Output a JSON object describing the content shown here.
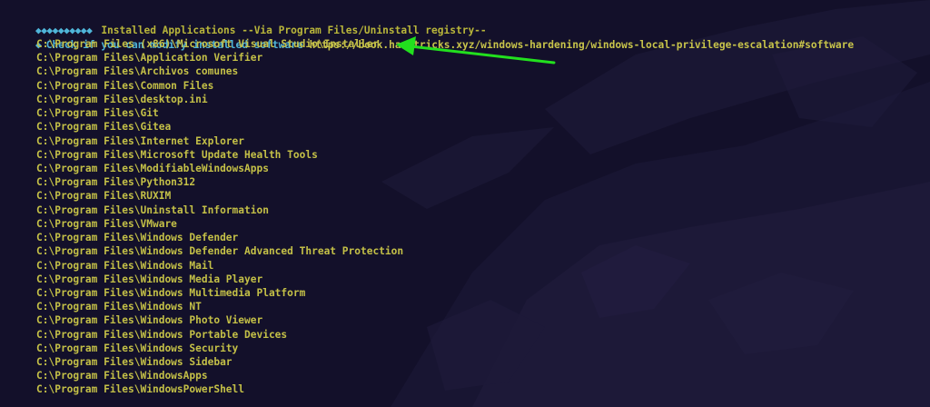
{
  "header": {
    "diamonds": "◆◆◆◆◆◆◆◆◆◆",
    "title": "Installed Applications --Via Program Files/Uninstall registry--"
  },
  "check": {
    "bullet": "◆",
    "text": "Check if you can modify installed software",
    "url": "https://book.hacktricks.xyz/windows-hardening/windows-local-privilege-escalation#software"
  },
  "paths": [
    "C:\\Program Files (x86)\\Microsoft Visual Studio\\Installer",
    "C:\\Program Files\\Application Verifier",
    "C:\\Program Files\\Archivos comunes",
    "C:\\Program Files\\Common Files",
    "C:\\Program Files\\desktop.ini",
    "C:\\Program Files\\Git",
    "C:\\Program Files\\Gitea",
    "C:\\Program Files\\Internet Explorer",
    "C:\\Program Files\\Microsoft Update Health Tools",
    "C:\\Program Files\\ModifiableWindowsApps",
    "C:\\Program Files\\Python312",
    "C:\\Program Files\\RUXIM",
    "C:\\Program Files\\Uninstall Information",
    "C:\\Program Files\\VMware",
    "C:\\Program Files\\Windows Defender",
    "C:\\Program Files\\Windows Defender Advanced Threat Protection",
    "C:\\Program Files\\Windows Mail",
    "C:\\Program Files\\Windows Media Player",
    "C:\\Program Files\\Windows Multimedia Platform",
    "C:\\Program Files\\Windows NT",
    "C:\\Program Files\\Windows Photo Viewer",
    "C:\\Program Files\\Windows Portable Devices",
    "C:\\Program Files\\Windows Security",
    "C:\\Program Files\\Windows Sidebar",
    "C:\\Program Files\\WindowsApps",
    "C:\\Program Files\\WindowsPowerShell"
  ],
  "colors": {
    "background": "#13102a",
    "heading_blue": "#4fb5d8",
    "path_yellow": "#c4c047",
    "arrow_green": "#22e01e"
  },
  "annotation": {
    "icon": "green-arrow-icon"
  }
}
